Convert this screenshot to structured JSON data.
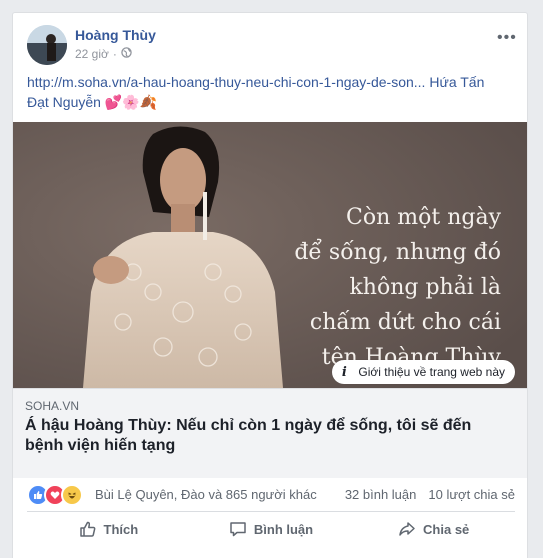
{
  "post": {
    "author": "Hoàng Thùy",
    "time": "22 giờ",
    "separator": "·",
    "more_glyph": "•••",
    "text_link": "http://m.soha.vn/a-hau-hoang-thuy-neu-chi-con-1-ngay-de-son...",
    "text_mention": " Hứa Tấn Đạt Nguyễn ",
    "text_emoji": "💕🌸🍂"
  },
  "preview": {
    "image_caption_lines": [
      "Còn một ngày",
      "để sống, nhưng đó",
      "không phải là",
      "chấm dứt cho cái",
      "tên Hoàng Thùy"
    ],
    "about_label": "Giới thiệu về trang web này",
    "domain": "SOHA.VN",
    "title": "Á hậu Hoàng Thùy: Nếu chỉ còn 1 ngày để sống, tôi sẽ đến bệnh viện hiến tạng"
  },
  "engagement": {
    "reaction_icons": [
      "like-icon",
      "love-icon",
      "haha-icon"
    ],
    "reactors": "Bùi Lệ Quyên, Đào và 865 người khác",
    "comments": "32 bình luận",
    "shares": "10 lượt chia sẻ"
  },
  "actions": {
    "like": "Thích",
    "comment": "Bình luận",
    "share": "Chia sẻ"
  },
  "colors": {
    "author_link": "#365899",
    "like_blue": "#4e8cf6",
    "love_red": "#f0425a",
    "haha_yellow": "#f7c84a"
  }
}
